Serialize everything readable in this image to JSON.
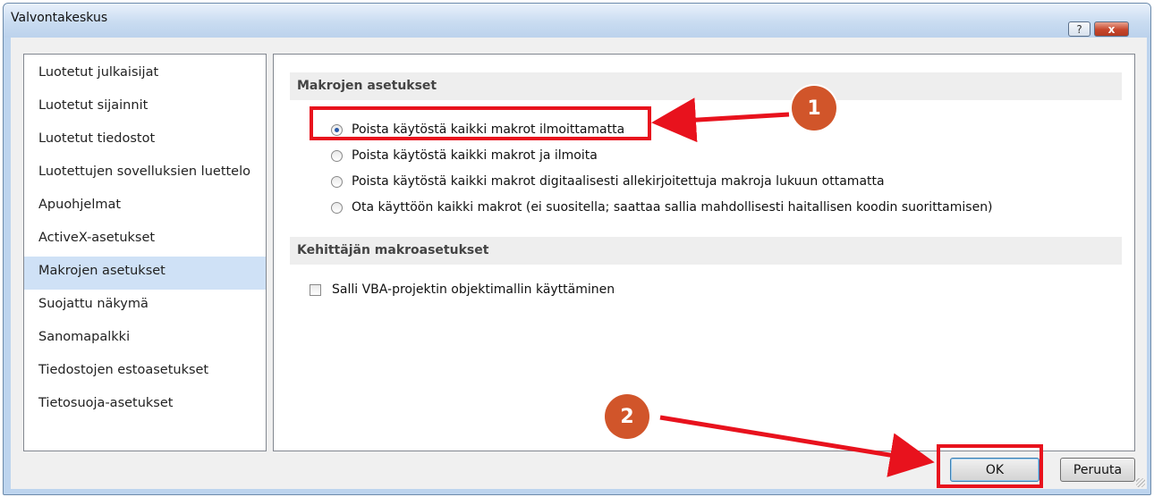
{
  "window": {
    "title": "Valvontakeskus",
    "help_label": "?",
    "close_label": "x"
  },
  "nav": {
    "items": [
      {
        "label": "Luotetut julkaisijat"
      },
      {
        "label": "Luotetut sijainnit"
      },
      {
        "label": "Luotetut tiedostot"
      },
      {
        "label": "Luotettujen sovelluksien luettelo"
      },
      {
        "label": "Apuohjelmat"
      },
      {
        "label": "ActiveX-asetukset"
      },
      {
        "label": "Makrojen asetukset",
        "selected": true
      },
      {
        "label": "Suojattu näkymä"
      },
      {
        "label": "Sanomapalkki"
      },
      {
        "label": "Tiedostojen estoasetukset"
      },
      {
        "label": "Tietosuoja-asetukset"
      }
    ]
  },
  "macro_settings": {
    "header": "Makrojen asetukset",
    "options": [
      {
        "label": "Poista käytöstä kaikki makrot ilmoittamatta",
        "checked": true
      },
      {
        "label": "Poista käytöstä kaikki makrot ja ilmoita",
        "checked": false
      },
      {
        "label": "Poista käytöstä kaikki makrot digitaalisesti allekirjoitettuja makroja lukuun ottamatta",
        "checked": false
      },
      {
        "label": "Ota käyttöön kaikki makrot (ei suositella; saattaa sallia mahdollisesti haitallisen koodin suorittamisen)",
        "checked": false
      }
    ]
  },
  "developer_settings": {
    "header": "Kehittäjän makroasetukset",
    "checkbox_label": "Salli VBA-projektin objektimallin käyttäminen",
    "checkbox_checked": false
  },
  "buttons": {
    "ok": "OK",
    "cancel": "Peruuta"
  },
  "annotations": {
    "badge_1": "1",
    "badge_2": "2",
    "highlight_color": "#e8121d",
    "badge_color": "#d1552a"
  }
}
